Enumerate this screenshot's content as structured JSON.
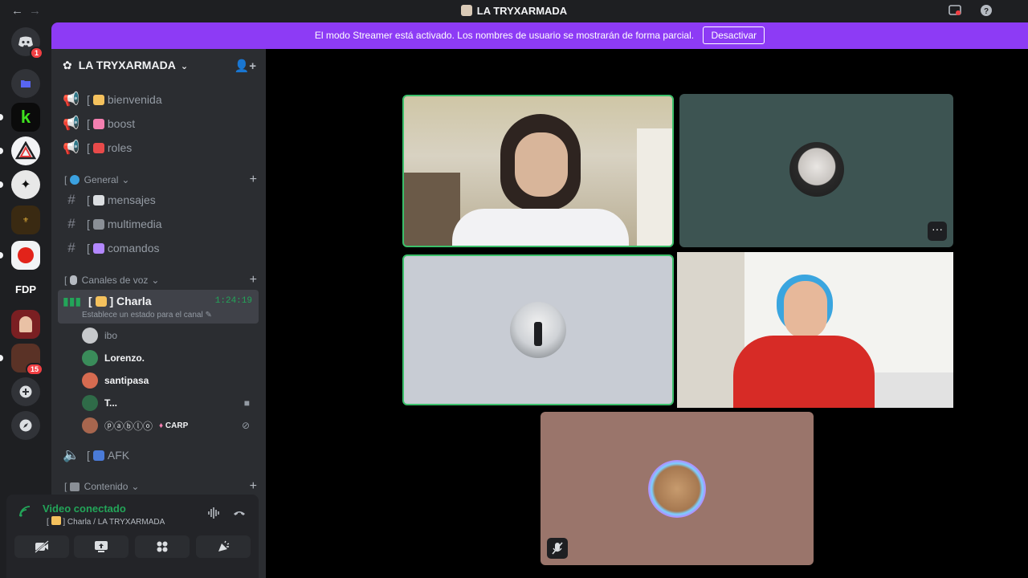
{
  "app": {
    "window_title": "LA TRYXARMADA"
  },
  "banner": {
    "text": "El modo Streamer está activado. Los nombres de usuario se mostrarán de forma parcial.",
    "button": "Desactivar"
  },
  "guilds": {
    "home_badge": "1",
    "fdp_label": "FDP",
    "last_badge": "15"
  },
  "server": {
    "name": "LA TRYXARMADA",
    "channels_top": [
      {
        "name": "bienvenida",
        "bracket": "[",
        "emoji_color": "#f4c15d"
      },
      {
        "name": "boost",
        "bracket": "[",
        "emoji_color": "#f47fb0"
      },
      {
        "name": "roles",
        "bracket": "[",
        "emoji_color": "#e84a4a"
      }
    ],
    "category_general": "General",
    "channels_general": [
      {
        "name": "mensajes",
        "bracket": "[",
        "emoji_color": "#dbdee1"
      },
      {
        "name": "multimedia",
        "bracket": "[",
        "emoji_color": "#8a8f96"
      },
      {
        "name": "comandos",
        "bracket": "[",
        "emoji_color": "#b388ff"
      }
    ],
    "category_voice": "Canales de voz",
    "active_voice": {
      "name": "Charla",
      "bracket": "[",
      "timer": "1:24:19",
      "status": "Establece un estado para el canal"
    },
    "voice_users": [
      {
        "name": "ibo",
        "av_color": "#c7c9cc"
      },
      {
        "name": "Lorenzo.",
        "av_color": "#3a8c5a"
      },
      {
        "name": "santipasa",
        "av_color": "#d66b50"
      },
      {
        "name": "T...",
        "av_color": "#2f6b48"
      },
      {
        "name": "ⓟⓐⓑⓛⓞ",
        "av_color": "#a7664e",
        "tag": "CARP"
      }
    ],
    "afk_channel": "AFK",
    "category_content": "Contenido"
  },
  "voice_panel": {
    "status": "Video conectado",
    "location": "Charla / LA TRYXARMADA"
  },
  "colors": {
    "brand_purple": "#8d3bf5",
    "speaking_green": "#3bbf6a",
    "sidebar": "#2b2d31",
    "background": "#1e1f22"
  }
}
